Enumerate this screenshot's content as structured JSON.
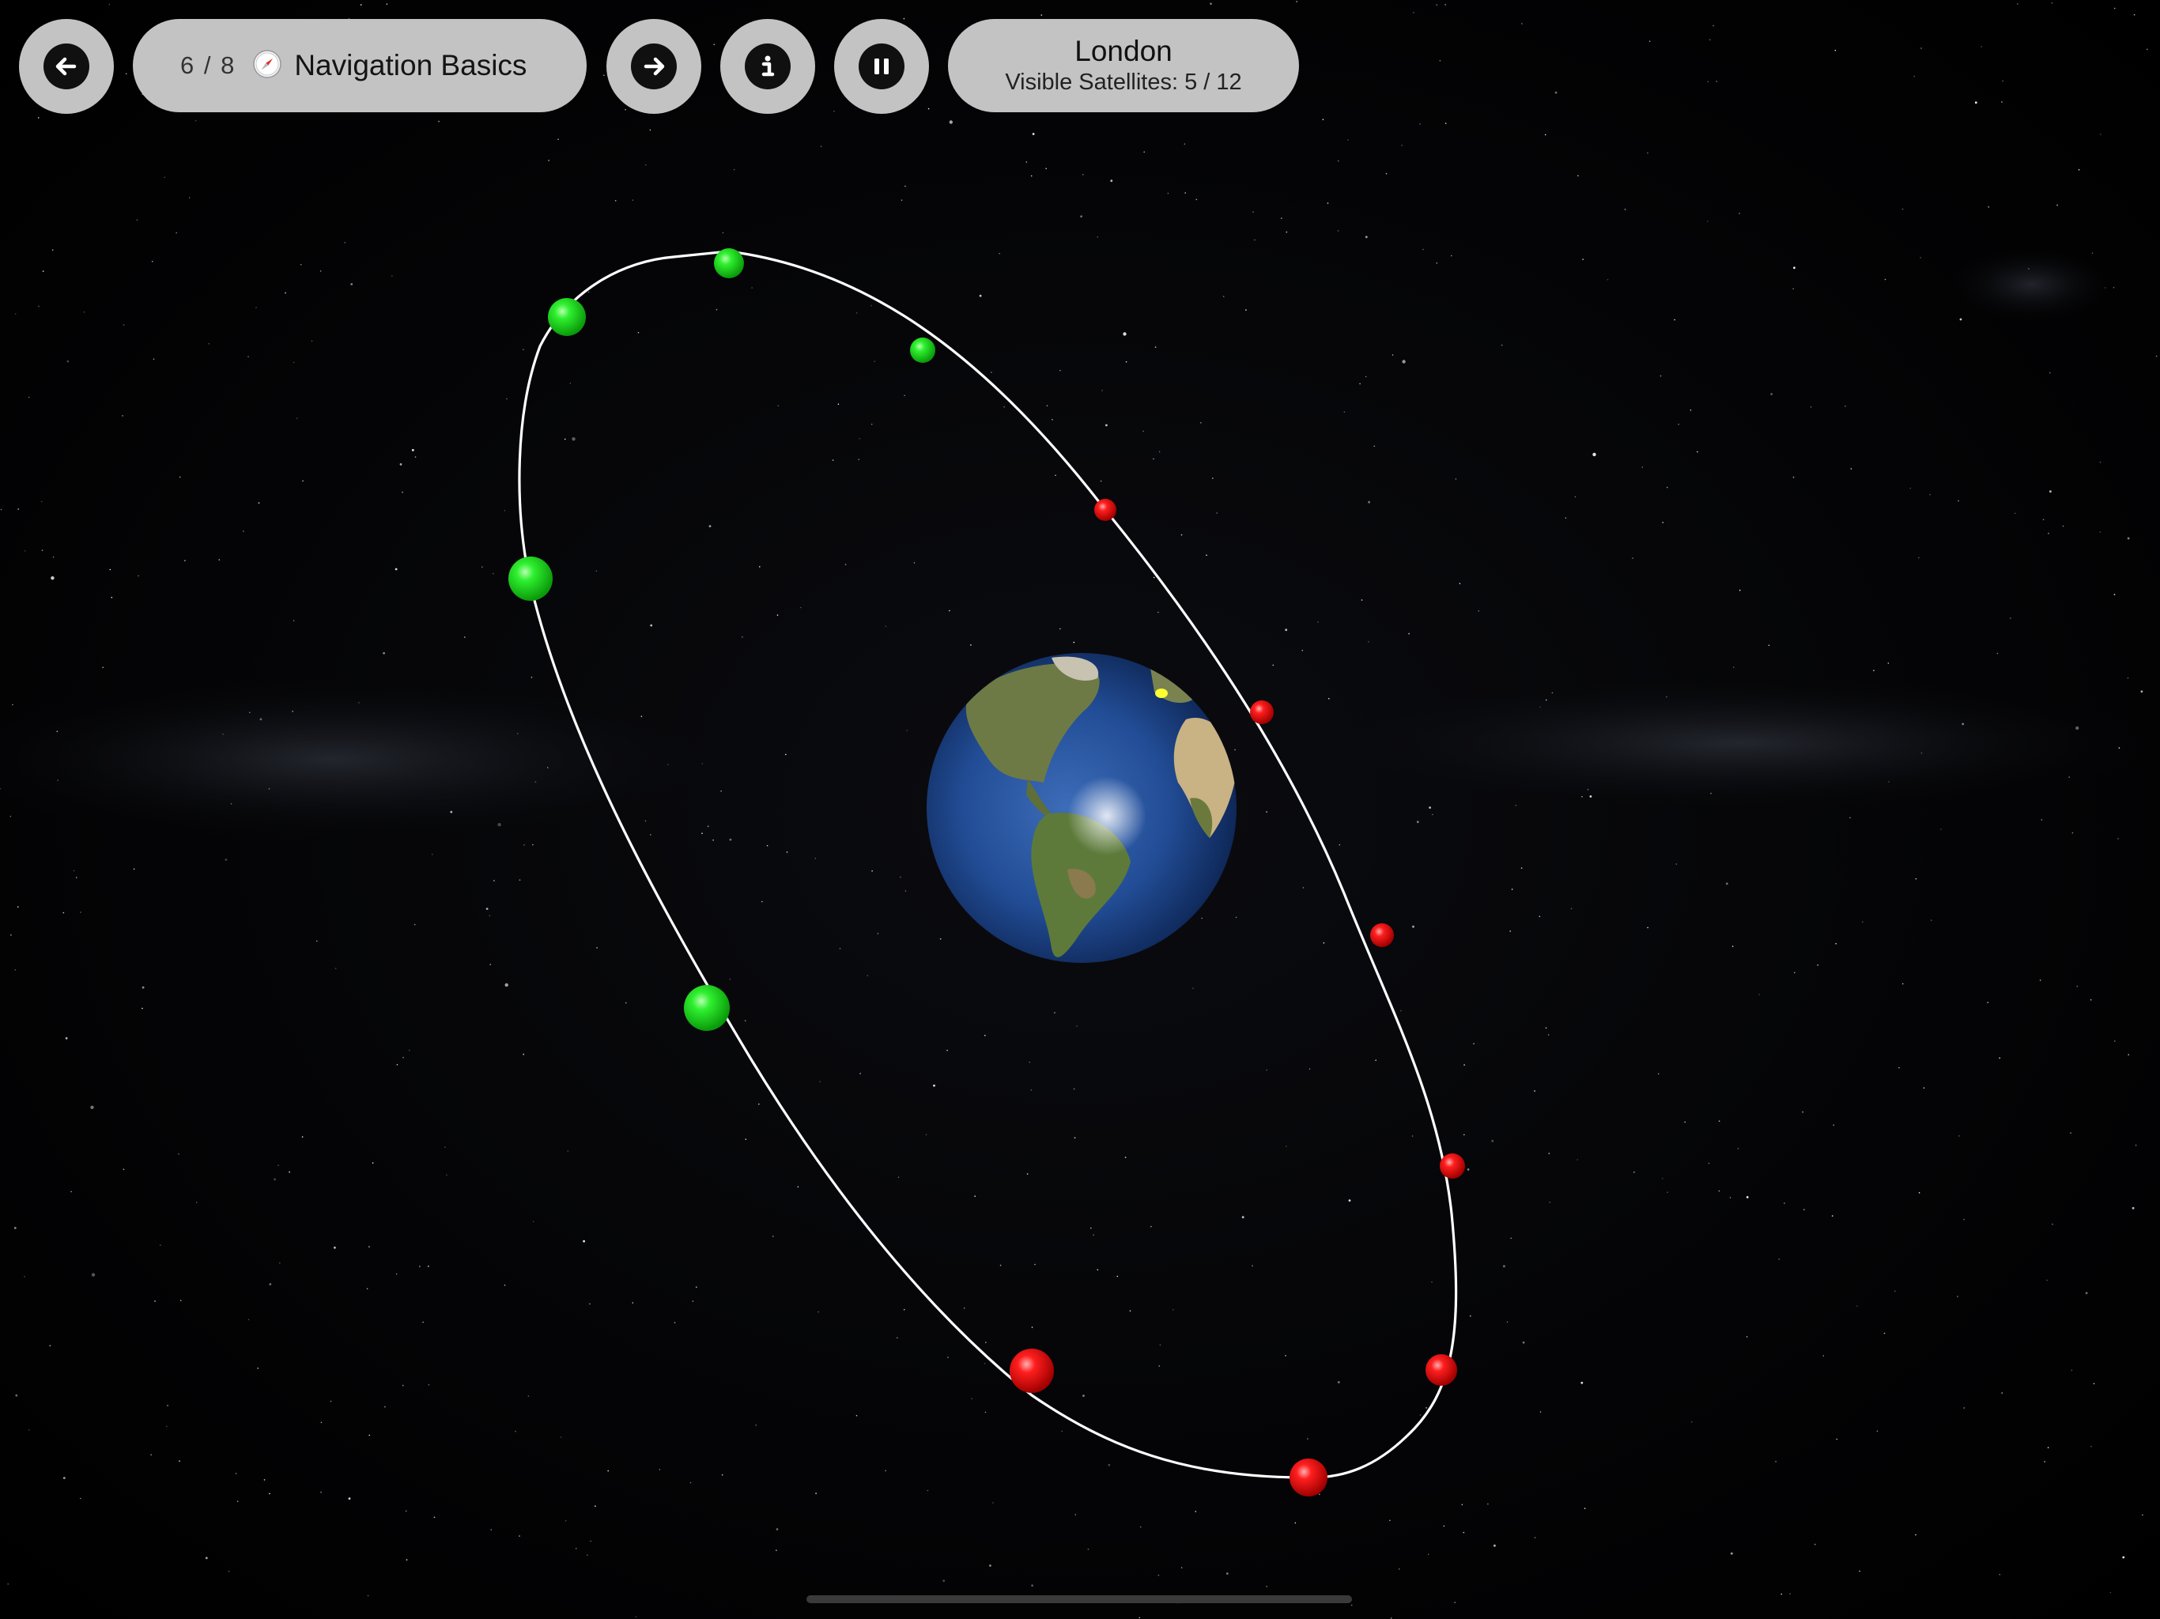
{
  "toolbar": {
    "back_icon": "arrow-left-icon",
    "lesson": {
      "counter": "6 / 8",
      "icon": "compass-icon",
      "title": "Navigation Basics"
    },
    "next_icon": "arrow-right-icon",
    "info_icon": "info-icon",
    "pause_icon": "pause-icon",
    "location": {
      "name": "London",
      "visible_satellites": "Visible Satellites: 5 / 12"
    }
  },
  "scene": {
    "satellites_total": 12,
    "satellites_visible": 5,
    "colors": {
      "visible": "#22e022",
      "not_visible": "#ff1a1a",
      "orbit": "#ffffff",
      "observer_marker": "#ffff33",
      "ocean": "#1f4a94"
    }
  }
}
